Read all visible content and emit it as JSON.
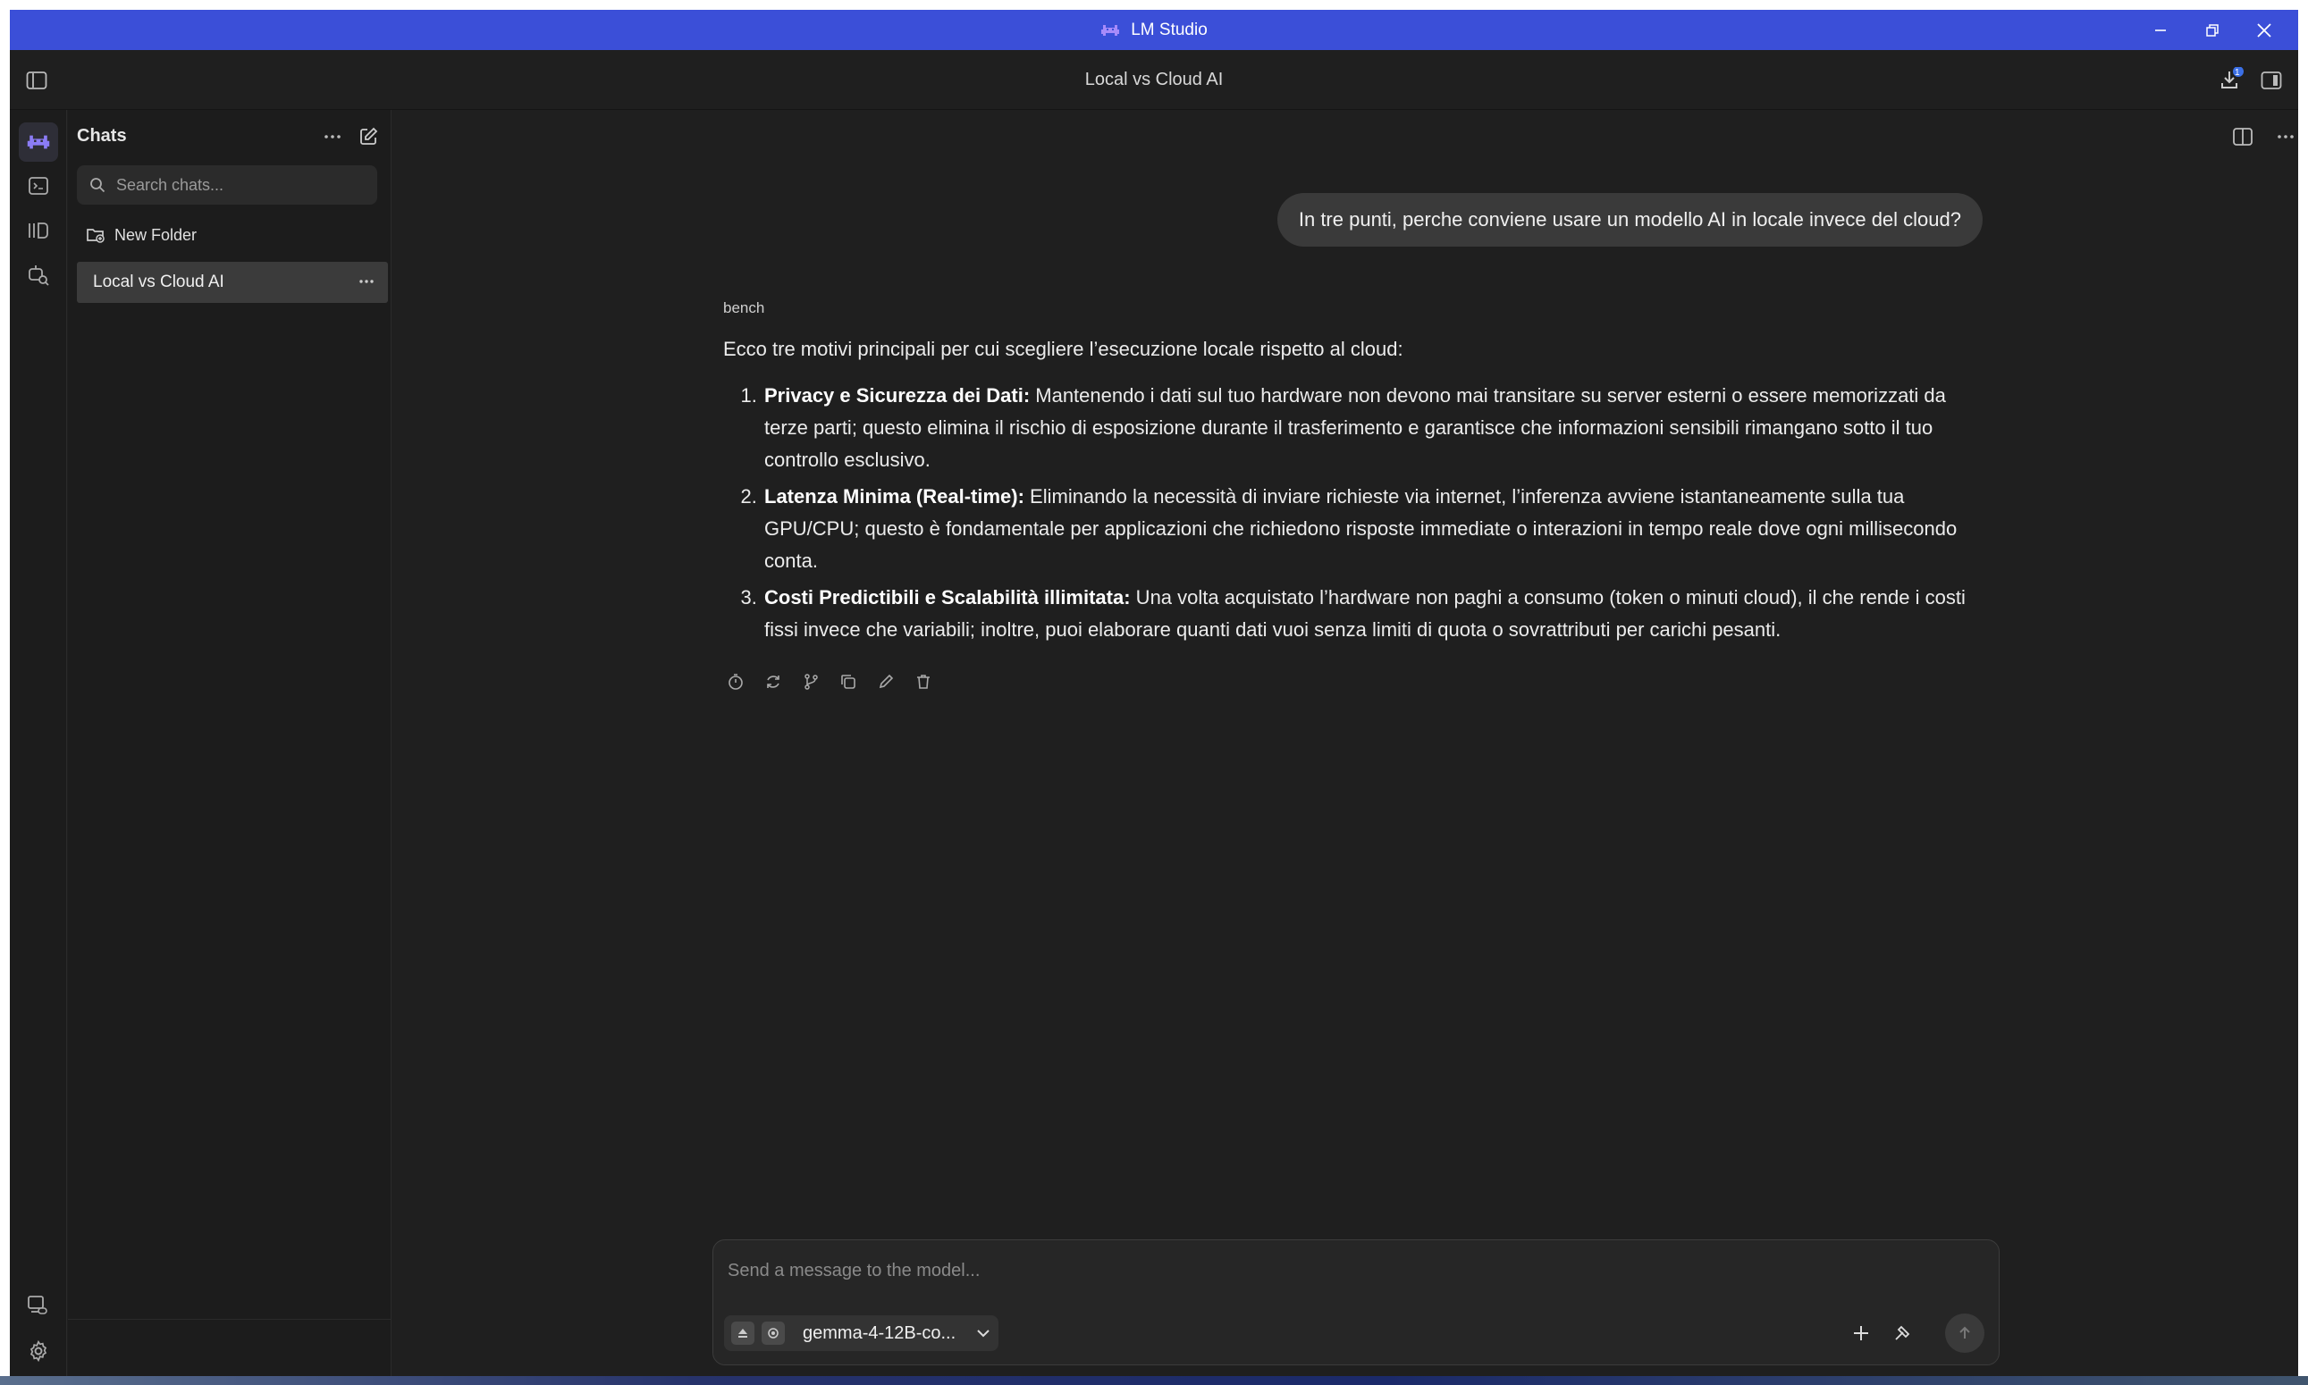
{
  "window": {
    "app_title": "LM Studio",
    "chat_title": "Local vs Cloud AI",
    "download_badge": "1",
    "brand_color": "#3b4fd8",
    "app_icon": "lm-studio-logo-icon"
  },
  "sidebar": {
    "title": "Chats",
    "search_placeholder": "Search chats...",
    "new_folder_label": "New Folder",
    "chats": [
      {
        "label": "Local vs Cloud AI",
        "selected": true
      }
    ]
  },
  "conversation": {
    "user_message": "In tre punti, perche conviene usare un modello AI in locale invece del cloud?",
    "assistant_name": "bench",
    "assistant_intro": "Ecco tre motivi principali per cui scegliere l’esecuzione locale rispetto al cloud:",
    "points": [
      {
        "title": "Privacy e Sicurezza dei Dati:",
        "text": " Mantenendo i dati sul tuo hardware non devono mai transitare su server esterni o essere memorizzati da terze parti; questo elimina il rischio di esposizione durante il trasferimento e garantisce che informazioni sensibili rimangano sotto il tuo controllo esclusivo."
      },
      {
        "title": "Latenza Minima (Real-time):",
        "text": " Eliminando la necessità di inviare richieste via internet, l’inferenza avviene istantaneamente sulla tua GPU/CPU; questo è fondamentale per applicazioni che richiedono risposte immediate o interazioni in tempo reale dove ogni millisecondo conta."
      },
      {
        "title": "Costi Predictibili e Scalabilità illimitata:",
        "text": " Una volta acquistato l’hardware non paghi a consumo (token o minuti cloud), il che rende i costi fissi invece che variabili; inoltre, puoi elaborare quanti dati vuoi senza limiti di quota o sovrattributi per carichi pesanti."
      }
    ],
    "message_actions": [
      "timer-icon",
      "regenerate-icon",
      "branch-icon",
      "copy-icon",
      "edit-icon",
      "delete-icon"
    ]
  },
  "composer": {
    "placeholder": "Send a message to the model...",
    "model_name": "gemma-4-12B-co..."
  }
}
